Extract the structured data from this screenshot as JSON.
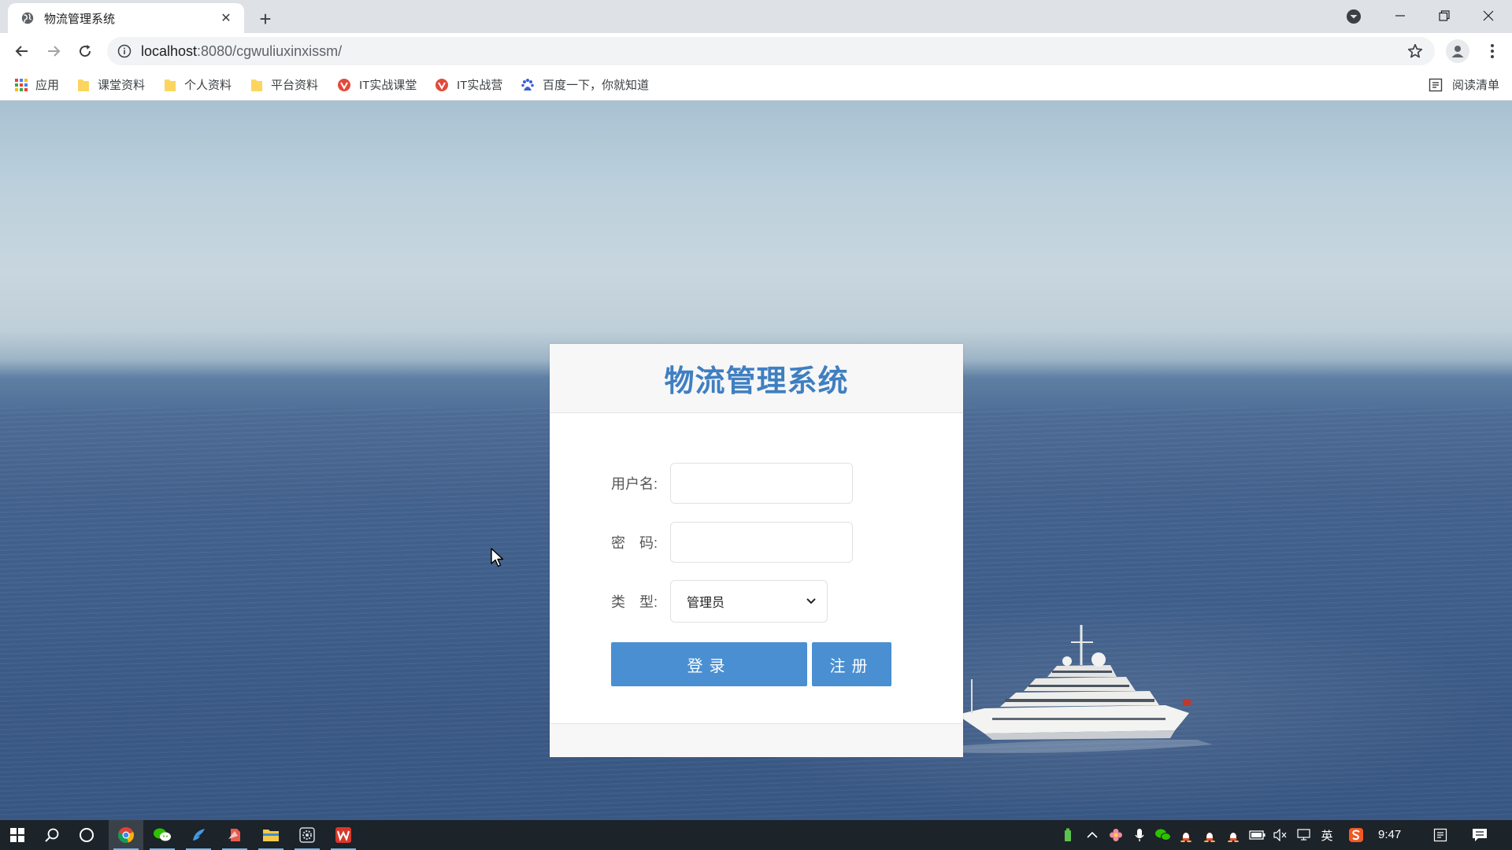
{
  "browser": {
    "tab_title": "物流管理系统",
    "url_host": "localhost",
    "url_path": ":8080/cgwuliuxinxissm/",
    "bookmarks": [
      {
        "label": "应用",
        "icon": "apps-grid-icon"
      },
      {
        "label": "课堂资料",
        "icon": "folder-icon"
      },
      {
        "label": "个人资料",
        "icon": "folder-icon"
      },
      {
        "label": "平台资料",
        "icon": "folder-icon"
      },
      {
        "label": "IT实战课堂",
        "icon": "site-red-icon"
      },
      {
        "label": "IT实战营",
        "icon": "site-red-icon"
      },
      {
        "label": "百度一下，你就知道",
        "icon": "baidu-paw-icon"
      }
    ],
    "reading_list": "阅读清单"
  },
  "login": {
    "title": "物流管理系统",
    "username_label": "用户名:",
    "username_value": "",
    "password_label": "密　码:",
    "password_value": "",
    "type_label": "类　型:",
    "type_selected": "管理员",
    "login_button": "登录",
    "register_button": "注册"
  },
  "taskbar": {
    "clock": "9:47",
    "ime": "英",
    "accent": "#76b9ed"
  },
  "colors": {
    "title_blue": "#3f7fc1",
    "button_blue": "#4a8fd1"
  }
}
